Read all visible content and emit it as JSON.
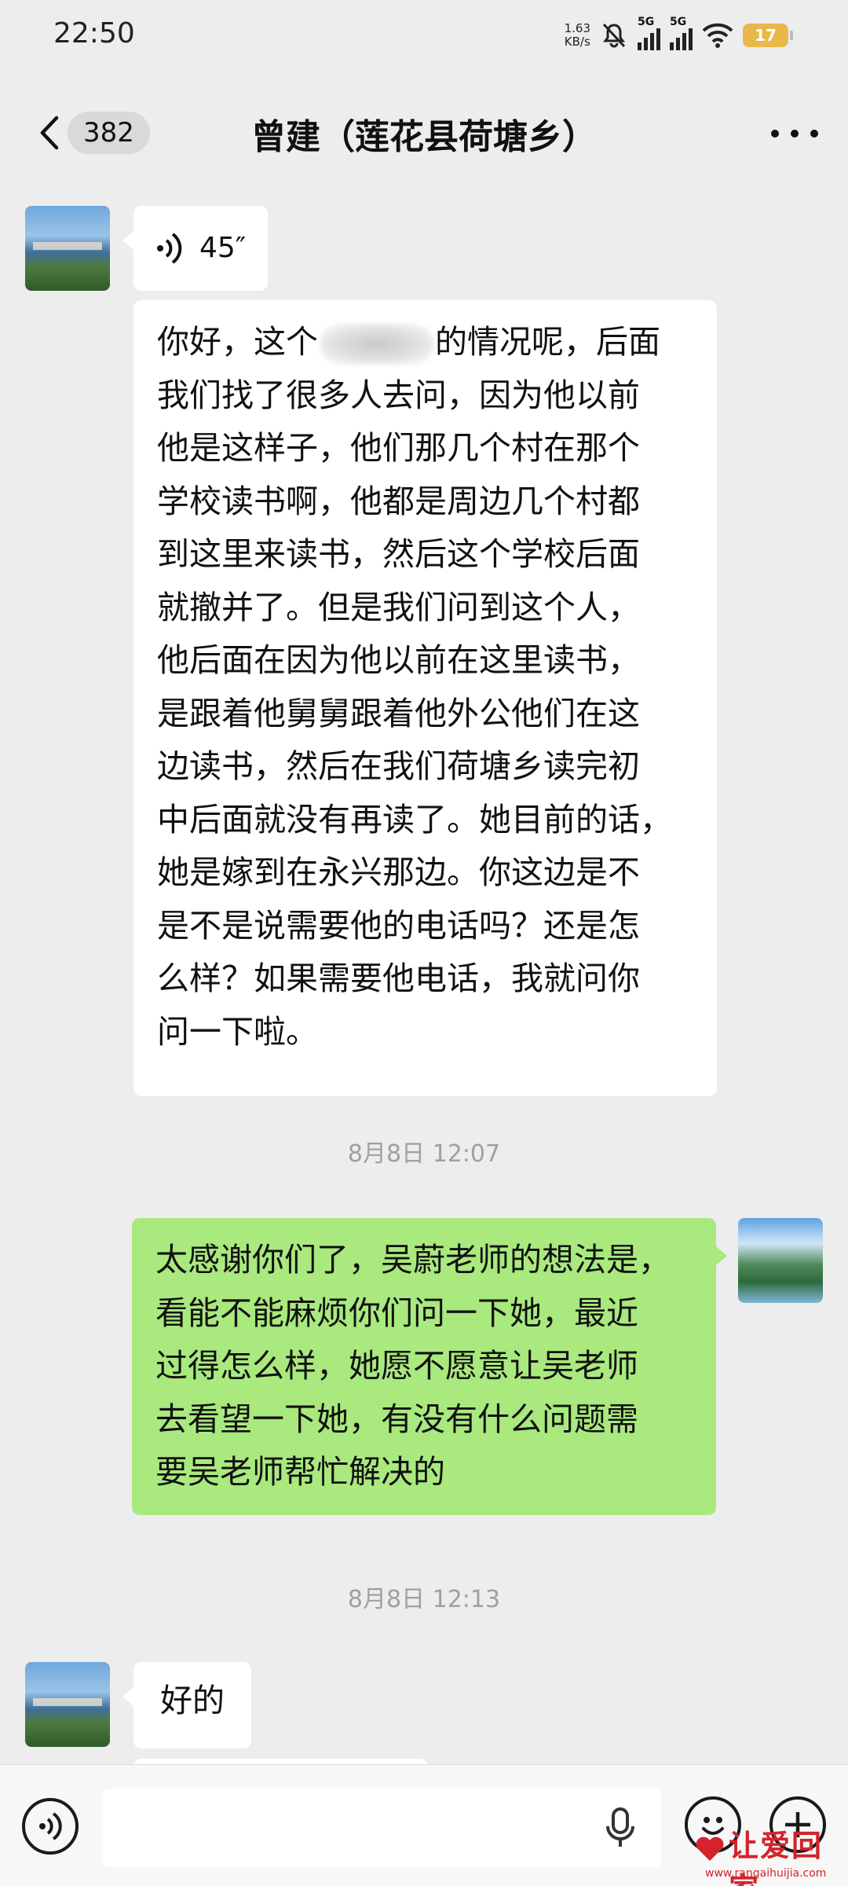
{
  "status_bar": {
    "time": "22:50",
    "net_speed_value": "1.63",
    "net_speed_unit": "KB/s",
    "sim1": "5G",
    "sim2": "5G",
    "battery": "17"
  },
  "header": {
    "unread_count": "382",
    "title": "曾建（莲花县荷塘乡）"
  },
  "messages": {
    "voice": {
      "duration": "45″"
    },
    "long_text": {
      "line1a": "你好，这个",
      "line1b": "的情况呢，后面",
      "line2": "我们找了很多人去问，因为他以前",
      "line3": "他是这样子，他们那几个村在那个",
      "line4": "学校读书啊，他都是周边几个村都",
      "line5": "到这里来读书，然后这个学校后面",
      "line6": "就撤并了。但是我们问到这个人，",
      "line7": "他后面在因为他以前在这里读书，",
      "line8": "是跟着他舅舅跟着他外公他们在这",
      "line9": "边读书，然后在我们荷塘乡读完初",
      "line10": "中后面就没有再读了。她目前的话，",
      "line11": "她是嫁到在永兴那边。你这边是不",
      "line12": "是不是说需要他的电话吗？还是怎",
      "line13": "么样？如果需要他电话，我就问你",
      "line14": "问一下啦。"
    },
    "timestamp1": "8月8日 12:07",
    "sent": {
      "line1": "太感谢你们了，吴蔚老师的想法是，",
      "line2": "看能不能麻烦你们问一下她，最近",
      "line3": "过得怎么样，她愿不愿意让吴老师",
      "line4": "去看望一下她，有没有什么问题需",
      "line5": "要吴老师帮忙解决的"
    },
    "timestamp2": "8月8日 12:13",
    "reply": "好的"
  },
  "input_bar": {
    "placeholder": ""
  },
  "watermark": {
    "text": "让爱回家",
    "url": "www.rangaihuijia.com"
  },
  "colors": {
    "sent_bubble": "#a9e97e",
    "received_bubble": "#ffffff",
    "background": "#ededed",
    "watermark": "#d4232b"
  },
  "icons": [
    "back-icon",
    "more-icon",
    "voice-wave-icon",
    "mic-icon",
    "emoji-icon",
    "plus-icon",
    "voice-toggle-icon"
  ]
}
